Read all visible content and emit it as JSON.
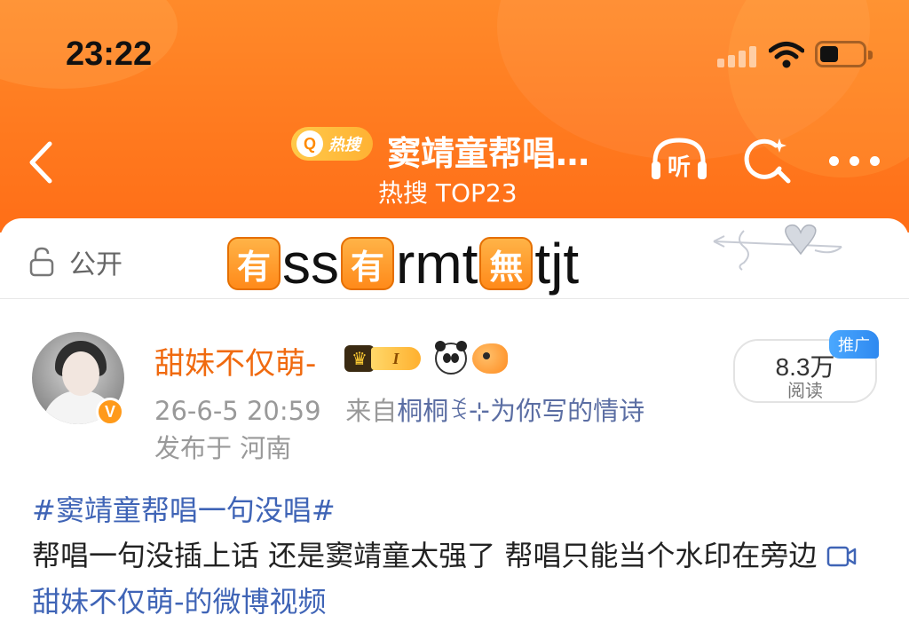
{
  "status_bar": {
    "time": "23:22"
  },
  "nav": {
    "hot_badge_q": "Q",
    "hot_badge_text": "热搜",
    "title": "窦靖童帮唱…",
    "subtitle": "热搜 TOP23",
    "listen_label": "听"
  },
  "card": {
    "visibility_label": "公开",
    "sticker": {
      "emoji1": "有",
      "text1": "ss ",
      "emoji2": "有",
      "text2": "rmt",
      "emoji3": "無",
      "text3": "tjt"
    }
  },
  "post": {
    "username": "甜妹不仅萌-",
    "level_badge": "I",
    "verified_mark": "V",
    "date": "26-6-5 20:59",
    "source_prefix": "来自",
    "source": "桐桐ꉂ⊹为你写的情诗",
    "location": "发布于 河南",
    "reads_count": "8.3万",
    "reads_label": "阅读",
    "promo_tag": "推广",
    "hashtag": "#窦靖童帮唱一句没唱#",
    "body_text": "帮唱一句没插上话 还是窦靖童太强了 帮唱只能当个水印在旁边",
    "video_link": "甜妹不仅萌-的微博视频"
  },
  "colors": {
    "header_orange": "#ff7a1f",
    "username_orange": "#f06a0f",
    "link_blue": "#3f64b6",
    "promo_blue": "#2f89f0"
  },
  "icons": [
    "back-icon",
    "listen-icon",
    "sparkle-search-icon",
    "more-icon",
    "lock-icon",
    "video-icon",
    "wifi-icon",
    "battery-icon",
    "signal-icon"
  ]
}
